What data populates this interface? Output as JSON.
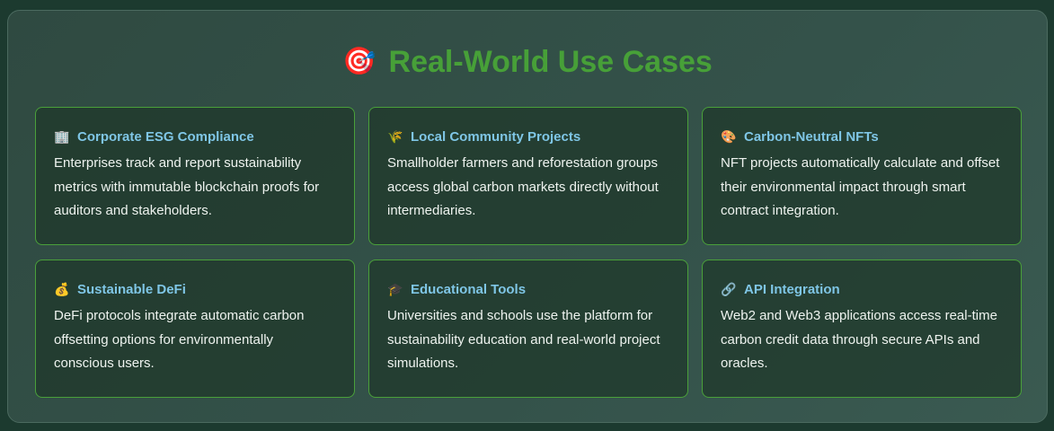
{
  "section": {
    "icon": "🎯",
    "title": "Real-World Use Cases"
  },
  "cards": [
    {
      "icon": "🏢",
      "icon_name": "office-building-icon",
      "title": "Corporate ESG Compliance",
      "body": "Enterprises track and report sustainability metrics with immutable blockchain proofs for auditors and stakeholders."
    },
    {
      "icon": "🌾",
      "icon_name": "sheaf-of-rice-icon",
      "title": "Local Community Projects",
      "body": "Smallholder farmers and reforestation groups access global carbon markets directly without intermediaries."
    },
    {
      "icon": "🎨",
      "icon_name": "artist-palette-icon",
      "title": "Carbon-Neutral NFTs",
      "body": "NFT projects automatically calculate and offset their environmental impact through smart contract integration."
    },
    {
      "icon": "💰",
      "icon_name": "money-bag-icon",
      "title": "Sustainable DeFi",
      "body": "DeFi protocols integrate automatic carbon offsetting options for environmentally conscious users."
    },
    {
      "icon": "🎓",
      "icon_name": "graduation-cap-icon",
      "title": "Educational Tools",
      "body": "Universities and schools use the platform for sustainability education and real-world project simulations."
    },
    {
      "icon": "🔗",
      "icon_name": "link-icon",
      "title": "API Integration",
      "body": "Web2 and Web3 applications access real-time carbon credit data through secure APIs and oracles."
    }
  ]
}
